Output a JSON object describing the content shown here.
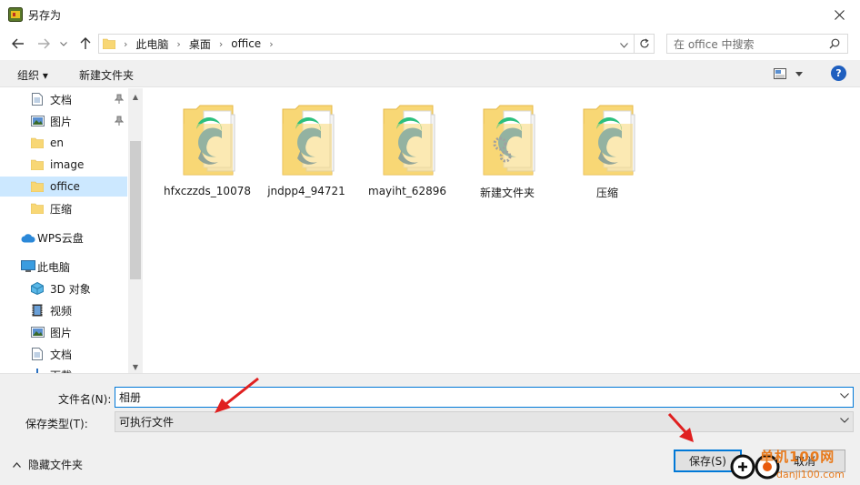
{
  "window": {
    "title": "另存为"
  },
  "address": {
    "crumbs": [
      "此电脑",
      "桌面",
      "office"
    ]
  },
  "search": {
    "placeholder": "在 office 中搜索"
  },
  "toolbar": {
    "organize": "组织 ▾",
    "new_folder": "新建文件夹"
  },
  "nav": {
    "items": [
      {
        "label": "文档",
        "icon": "document-icon"
      },
      {
        "label": "图片",
        "icon": "picture-icon"
      },
      {
        "label": "en",
        "icon": "folder-icon"
      },
      {
        "label": "image",
        "icon": "folder-icon"
      },
      {
        "label": "office",
        "icon": "folder-icon"
      },
      {
        "label": "压缩",
        "icon": "folder-icon"
      },
      {
        "label": "WPS云盘",
        "icon": "cloud-icon"
      },
      {
        "label": "此电脑",
        "icon": "computer-icon"
      },
      {
        "label": "3D 对象",
        "icon": "3d-objects-icon"
      },
      {
        "label": "视频",
        "icon": "video-icon"
      },
      {
        "label": "图片",
        "icon": "picture-icon"
      },
      {
        "label": "文档",
        "icon": "document-icon"
      },
      {
        "label": "下载",
        "icon": "download-icon"
      }
    ]
  },
  "files": [
    {
      "name": "hfxczzds_10078",
      "icon": "edge-folder-icon"
    },
    {
      "name": "jndpp4_94721",
      "icon": "edge-folder-icon"
    },
    {
      "name": "mayiht_62896",
      "icon": "edge-folder-icon"
    },
    {
      "name": "新建文件夹",
      "icon": "gear-folder-icon"
    },
    {
      "name": "压缩",
      "icon": "edge-folder-icon"
    }
  ],
  "form": {
    "filename_label": "文件名(N):",
    "filename_value": "相册",
    "filetype_label": "保存类型(T):",
    "filetype_value": "可执行文件"
  },
  "footer": {
    "hide_folders": "隐藏文件夹",
    "save": "保存(S)",
    "cancel": "取消"
  },
  "watermark": {
    "text": "单机100网",
    "url_text": "danji100.com"
  },
  "colors": {
    "accent": "#0078d7",
    "selection": "#cce8ff",
    "folder": "#f8d775",
    "annotation_arrow": "#e02020"
  }
}
